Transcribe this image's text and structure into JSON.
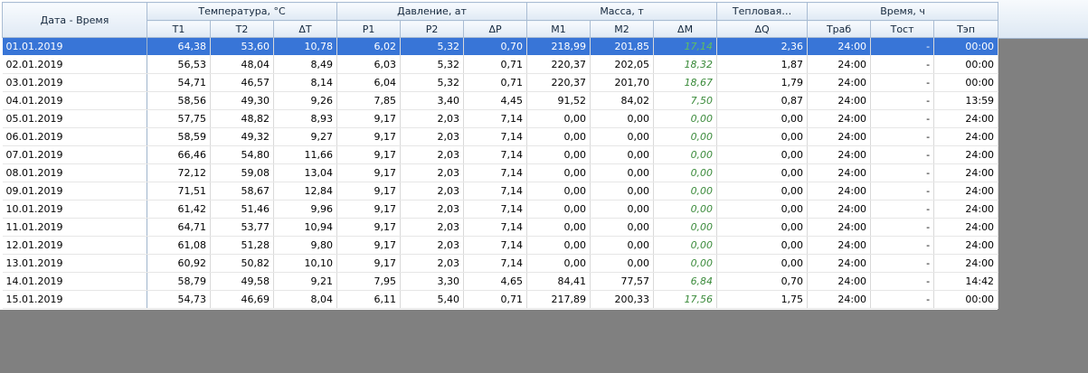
{
  "header": {
    "date_col": "Дата - Время",
    "groups": [
      "Температура, °С",
      "Давление, ат",
      "Масса, т",
      "Тепловая…",
      "Время, ч"
    ],
    "columns": [
      "T1",
      "T2",
      "ΔT",
      "P1",
      "P2",
      "ΔP",
      "M1",
      "M2",
      "ΔM",
      "ΔQ",
      "Траб",
      "Тост",
      "Тэп"
    ]
  },
  "colors": {
    "selection": "#3875d7",
    "delta_mass": "#3a8a3a",
    "background": "#808080"
  },
  "rows": [
    [
      "01.01.2019",
      "64,38",
      "53,60",
      "10,78",
      "6,02",
      "5,32",
      "0,70",
      "218,99",
      "201,85",
      "17,14",
      "2,36",
      "24:00",
      "-",
      "00:00"
    ],
    [
      "02.01.2019",
      "56,53",
      "48,04",
      "8,49",
      "6,03",
      "5,32",
      "0,71",
      "220,37",
      "202,05",
      "18,32",
      "1,87",
      "24:00",
      "-",
      "00:00"
    ],
    [
      "03.01.2019",
      "54,71",
      "46,57",
      "8,14",
      "6,04",
      "5,32",
      "0,71",
      "220,37",
      "201,70",
      "18,67",
      "1,79",
      "24:00",
      "-",
      "00:00"
    ],
    [
      "04.01.2019",
      "58,56",
      "49,30",
      "9,26",
      "7,85",
      "3,40",
      "4,45",
      "91,52",
      "84,02",
      "7,50",
      "0,87",
      "24:00",
      "-",
      "13:59"
    ],
    [
      "05.01.2019",
      "57,75",
      "48,82",
      "8,93",
      "9,17",
      "2,03",
      "7,14",
      "0,00",
      "0,00",
      "0,00",
      "0,00",
      "24:00",
      "-",
      "24:00"
    ],
    [
      "06.01.2019",
      "58,59",
      "49,32",
      "9,27",
      "9,17",
      "2,03",
      "7,14",
      "0,00",
      "0,00",
      "0,00",
      "0,00",
      "24:00",
      "-",
      "24:00"
    ],
    [
      "07.01.2019",
      "66,46",
      "54,80",
      "11,66",
      "9,17",
      "2,03",
      "7,14",
      "0,00",
      "0,00",
      "0,00",
      "0,00",
      "24:00",
      "-",
      "24:00"
    ],
    [
      "08.01.2019",
      "72,12",
      "59,08",
      "13,04",
      "9,17",
      "2,03",
      "7,14",
      "0,00",
      "0,00",
      "0,00",
      "0,00",
      "24:00",
      "-",
      "24:00"
    ],
    [
      "09.01.2019",
      "71,51",
      "58,67",
      "12,84",
      "9,17",
      "2,03",
      "7,14",
      "0,00",
      "0,00",
      "0,00",
      "0,00",
      "24:00",
      "-",
      "24:00"
    ],
    [
      "10.01.2019",
      "61,42",
      "51,46",
      "9,96",
      "9,17",
      "2,03",
      "7,14",
      "0,00",
      "0,00",
      "0,00",
      "0,00",
      "24:00",
      "-",
      "24:00"
    ],
    [
      "11.01.2019",
      "64,71",
      "53,77",
      "10,94",
      "9,17",
      "2,03",
      "7,14",
      "0,00",
      "0,00",
      "0,00",
      "0,00",
      "24:00",
      "-",
      "24:00"
    ],
    [
      "12.01.2019",
      "61,08",
      "51,28",
      "9,80",
      "9,17",
      "2,03",
      "7,14",
      "0,00",
      "0,00",
      "0,00",
      "0,00",
      "24:00",
      "-",
      "24:00"
    ],
    [
      "13.01.2019",
      "60,92",
      "50,82",
      "10,10",
      "9,17",
      "2,03",
      "7,14",
      "0,00",
      "0,00",
      "0,00",
      "0,00",
      "24:00",
      "-",
      "24:00"
    ],
    [
      "14.01.2019",
      "58,79",
      "49,58",
      "9,21",
      "7,95",
      "3,30",
      "4,65",
      "84,41",
      "77,57",
      "6,84",
      "0,70",
      "24:00",
      "-",
      "14:42"
    ],
    [
      "15.01.2019",
      "54,73",
      "46,69",
      "8,04",
      "6,11",
      "5,40",
      "0,71",
      "217,89",
      "200,33",
      "17,56",
      "1,75",
      "24:00",
      "-",
      "00:00"
    ]
  ]
}
